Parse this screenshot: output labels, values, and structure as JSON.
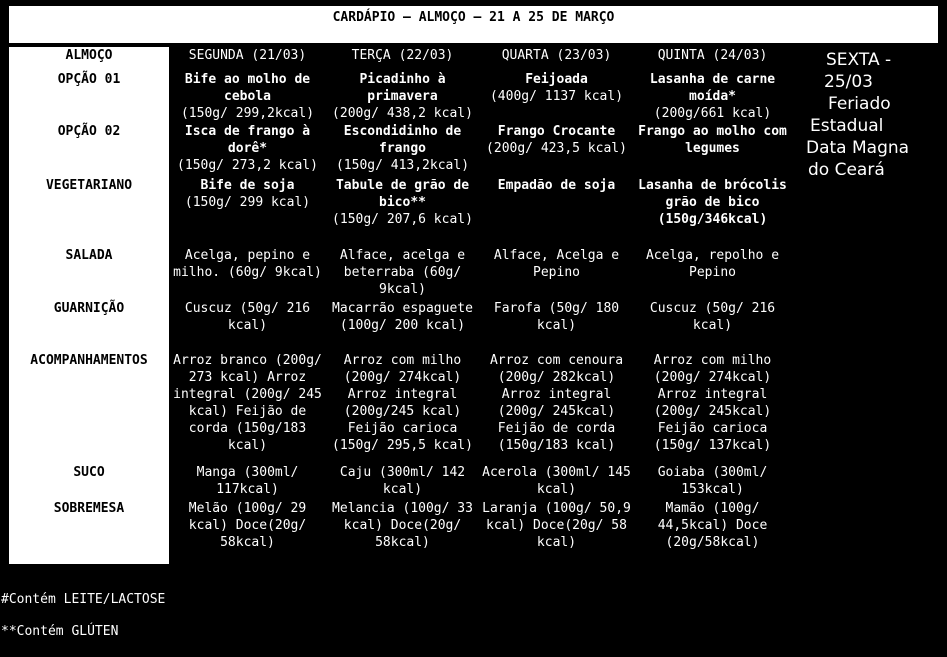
{
  "title": "CARDÁPIO – ALMOÇO – 21 A 25 DE MARÇO",
  "header": {
    "label": "ALMOÇO",
    "days": [
      "SEGUNDA (21/03)",
      "TERÇA (22/03)",
      "QUARTA (23/03)",
      "QUINTA (24/03)"
    ]
  },
  "rows": [
    {
      "label": "OPÇÃO 01",
      "cells": [
        [
          "Bife ao molho de cebola",
          "(150g/ 299,2kcal)"
        ],
        [
          "Picadinho à primavera",
          "(200g/ 438,2 kcal)"
        ],
        [
          "Feijoada",
          "(400g/ 1137 kcal)"
        ],
        [
          "Lasanha de carne moída*",
          "(200g/661 kcal)"
        ]
      ]
    },
    {
      "label": "OPÇÃO 02",
      "cells": [
        [
          "Isca de frango à dorê*",
          "(150g/ 273,2 kcal)"
        ],
        [
          "Escondidinho de frango",
          "(150g/ 413,2kcal)"
        ],
        [
          "Frango Crocante",
          "(200g/ 423,5 kcal)"
        ],
        [
          "Frango ao molho com legumes",
          ""
        ]
      ]
    },
    {
      "label": "VEGETARIANO",
      "cells": [
        [
          "Bife de soja",
          "(150g/ 299 kcal)"
        ],
        [
          "Tabule de grão de bico**",
          "(150g/ 207,6 kcal)"
        ],
        [
          "Empadão de soja",
          ""
        ],
        [
          "Lasanha de brócolis grão de bico",
          "(150g/346kcal)"
        ]
      ]
    },
    {
      "label": "SALADA",
      "cells": [
        "Acelga, pepino e milho. (60g/ 9kcal)",
        "Alface, acelga e beterraba (60g/ 9kcal)",
        "Alface, Acelga e Pepino",
        "Acelga, repolho e Pepino"
      ]
    },
    {
      "label": "GUARNIÇÃO",
      "cells": [
        "Cuscuz (50g/ 216 kcal)",
        "Macarrão espaguete (100g/ 200 kcal)",
        "Farofa (50g/ 180 kcal)",
        "Cuscuz (50g/ 216 kcal)"
      ]
    },
    {
      "label": "ACOMPANHAMENTOS",
      "cells": [
        "Arroz branco (200g/ 273 kcal) Arroz integral (200g/ 245 kcal) Feijão de corda (150g/183 kcal)",
        "Arroz com milho (200g/ 274kcal) Arroz integral (200g/245 kcal) Feijão carioca (150g/ 295,5 kcal)",
        "Arroz com cenoura (200g/ 282kcal) Arroz integral (200g/ 245kcal) Feijão de corda (150g/183 kcal)",
        "Arroz com milho (200g/ 274kcal) Arroz integral (200g/ 245kcal) Feijão carioca (150g/ 137kcal)"
      ]
    },
    {
      "label": "SUCO",
      "cells": [
        "Manga (300ml/ 117kcal)",
        "Caju (300ml/ 142 kcal)",
        "Acerola (300ml/ 145 kcal)",
        "Goiaba (300ml/ 153kcal)"
      ]
    },
    {
      "label": "SOBREMESA",
      "cells": [
        "Melão (100g/ 29 kcal) Doce(20g/ 58kcal)",
        "Melancia (100g/ 33 kcal) Doce(20g/ 58kcal)",
        "Laranja (100g/ 50,9 kcal) Doce(20g/ 58 kcal)",
        "Mamão (100g/ 44,5kcal) Doce (20g/58kcal)"
      ]
    }
  ],
  "sexta": [
    "SEXTA -",
    "25/03",
    "Feriado",
    "Estadual",
    "Data Magna",
    "do Ceará"
  ],
  "footnotes": [
    "#Contém LEITE/LACTOSE",
    "**Contém GLÚTEN"
  ]
}
